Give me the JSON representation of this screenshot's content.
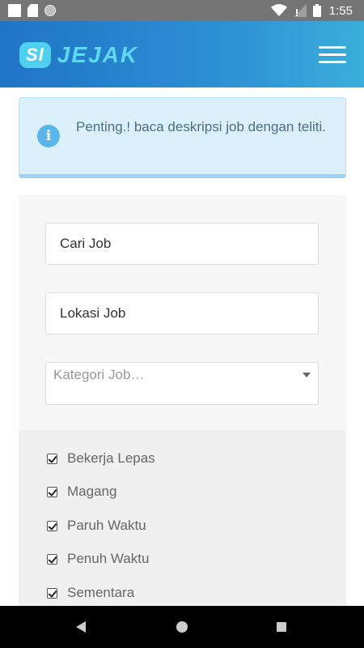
{
  "status_bar": {
    "time": "1:55",
    "icons": [
      "notification-square-icon",
      "sd-card-icon",
      "sync-circle-icon",
      "wifi-icon",
      "no-signal-icon",
      "battery-icon"
    ]
  },
  "header": {
    "logo_si": "SI",
    "logo_jejak": "JEJAK",
    "menu_icon": "hamburger-menu-icon"
  },
  "alert": {
    "icon": "info-icon",
    "icon_glyph": "i",
    "text": "Penting.! baca deskripsi job dengan teliti."
  },
  "search_form": {
    "job_field": {
      "value": "Cari Job"
    },
    "location_field": {
      "value": "Lokasi Job"
    },
    "category_select": {
      "placeholder": "Kategori Job…"
    }
  },
  "job_types": [
    {
      "label": "Bekerja Lepas",
      "checked": true
    },
    {
      "label": "Magang",
      "checked": true
    },
    {
      "label": "Paruh Waktu",
      "checked": true
    },
    {
      "label": "Penuh Waktu",
      "checked": true
    },
    {
      "label": "Sementara",
      "checked": true
    }
  ],
  "nav_bar": {
    "buttons": [
      "back-icon",
      "home-icon",
      "recent-apps-icon"
    ]
  },
  "colors": {
    "header_start": "#1f74c6",
    "header_end": "#3aaedb",
    "logo_accent": "#4fd0ef",
    "alert_bg": "#dcf0fb",
    "info_icon": "#58b6ea"
  }
}
